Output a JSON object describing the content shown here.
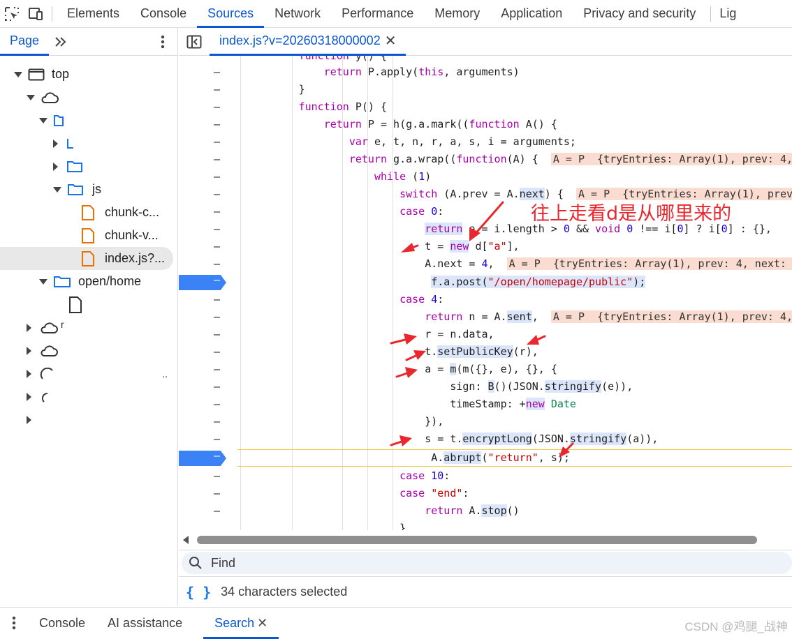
{
  "top_tabs": [
    "Elements",
    "Console",
    "Sources",
    "Network",
    "Performance",
    "Memory",
    "Application",
    "Privacy and security",
    "Lig"
  ],
  "active_top_tab": "Sources",
  "sidebar": {
    "tab": "Page",
    "tree": [
      {
        "label": "top",
        "icon": "frame-icon"
      },
      {
        "label": "",
        "icon": "cloud-icon"
      },
      {
        "label": "",
        "icon": "folder-icon"
      },
      {
        "label": "",
        "icon": "folder-icon"
      },
      {
        "label": "",
        "icon": "folder-icon"
      },
      {
        "label": "js",
        "icon": "folder-icon"
      },
      {
        "label": "chunk-c...",
        "icon": "file-icon"
      },
      {
        "label": "chunk-v...",
        "icon": "file-icon"
      },
      {
        "label": "index.js?...",
        "icon": "file-icon"
      },
      {
        "label": "open/home",
        "icon": "folder-icon"
      },
      {
        "label": "",
        "icon": "document-icon"
      },
      {
        "label": "r",
        "icon": "cloud-icon"
      },
      {
        "label": "",
        "icon": "cloud-icon"
      },
      {
        "label": "..",
        "icon": "cloud-icon"
      },
      {
        "label": "",
        "icon": "cloud-icon"
      },
      {
        "label": "",
        "icon": "none"
      }
    ]
  },
  "editor": {
    "file_tab": "index.js?v=20260318000002"
  },
  "find": {
    "label": "Find"
  },
  "status": {
    "text": "34 characters selected"
  },
  "drawer": {
    "tabs": [
      "Console",
      "AI assistance",
      "Search"
    ],
    "active": "Search"
  },
  "annotation": "往上走看d是从哪里来的",
  "watermark": "CSDN @鸡腿_战神",
  "colors": {
    "accent": "#0b57d0",
    "breakpoint": "#3b82f6",
    "arrow": "#e8282e"
  }
}
